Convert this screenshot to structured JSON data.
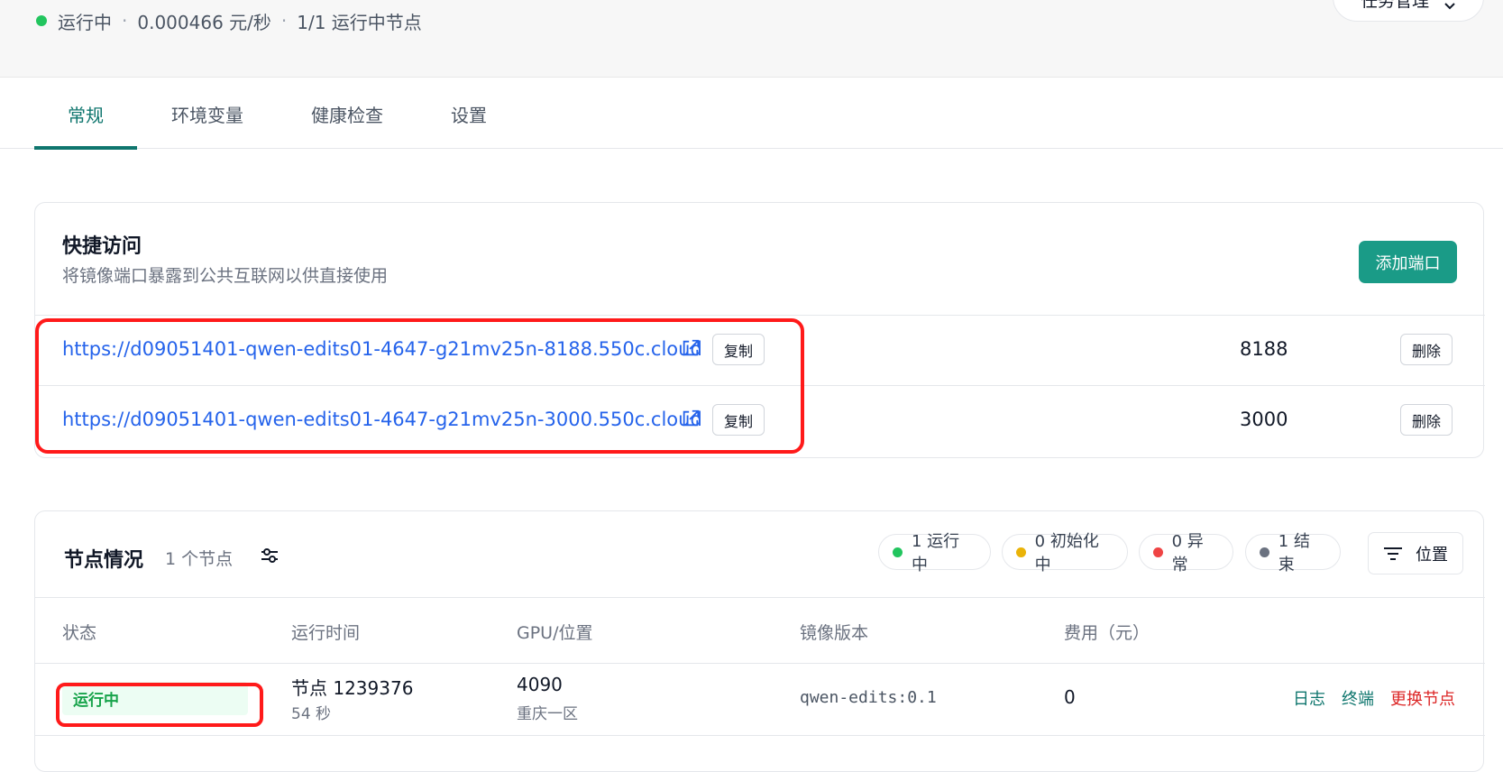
{
  "header": {
    "status": "运行中",
    "price": "0.000466 元/秒",
    "nodes_running": "1/1 运行中节点",
    "task_button": "任务管理",
    "colors": {
      "running_dot": "#22c55e"
    }
  },
  "tabs": [
    {
      "label": "常规",
      "active": true
    },
    {
      "label": "环境变量",
      "active": false
    },
    {
      "label": "健康检查",
      "active": false
    },
    {
      "label": "设置",
      "active": false
    }
  ],
  "quick_access": {
    "title": "快捷访问",
    "subtitle": "将镜像端口暴露到公共互联网以供直接使用",
    "add_button": "添加端口",
    "ports": [
      {
        "url": "https://d09051401-qwen-edits01-4647-g21mv25n-8188.550c.cloud",
        "copy": "复制",
        "port": "8188",
        "delete": "删除"
      },
      {
        "url": "https://d09051401-qwen-edits01-4647-g21mv25n-3000.550c.cloud",
        "copy": "复制",
        "port": "3000",
        "delete": "删除"
      }
    ]
  },
  "nodes": {
    "title": "节点情况",
    "count": "1 个节点",
    "pills": [
      {
        "label": "1 运行中",
        "color": "#22c55e"
      },
      {
        "label": "0 初始化中",
        "color": "#eab308"
      },
      {
        "label": "0 异常",
        "color": "#ef4444"
      },
      {
        "label": "1 结束",
        "color": "#6b7280"
      }
    ],
    "position_button": "位置",
    "columns": [
      "状态",
      "运行时间",
      "GPU/位置",
      "镜像版本",
      "费用（元）"
    ],
    "rows": [
      {
        "status": "运行中",
        "node": "节点 1239376",
        "uptime": "54 秒",
        "gpu": "4090",
        "location": "重庆一区",
        "image": "qwen-edits:0.1",
        "cost": "0",
        "actions": {
          "log": "日志",
          "terminal": "终端",
          "replace": "更换节点"
        }
      }
    ]
  }
}
